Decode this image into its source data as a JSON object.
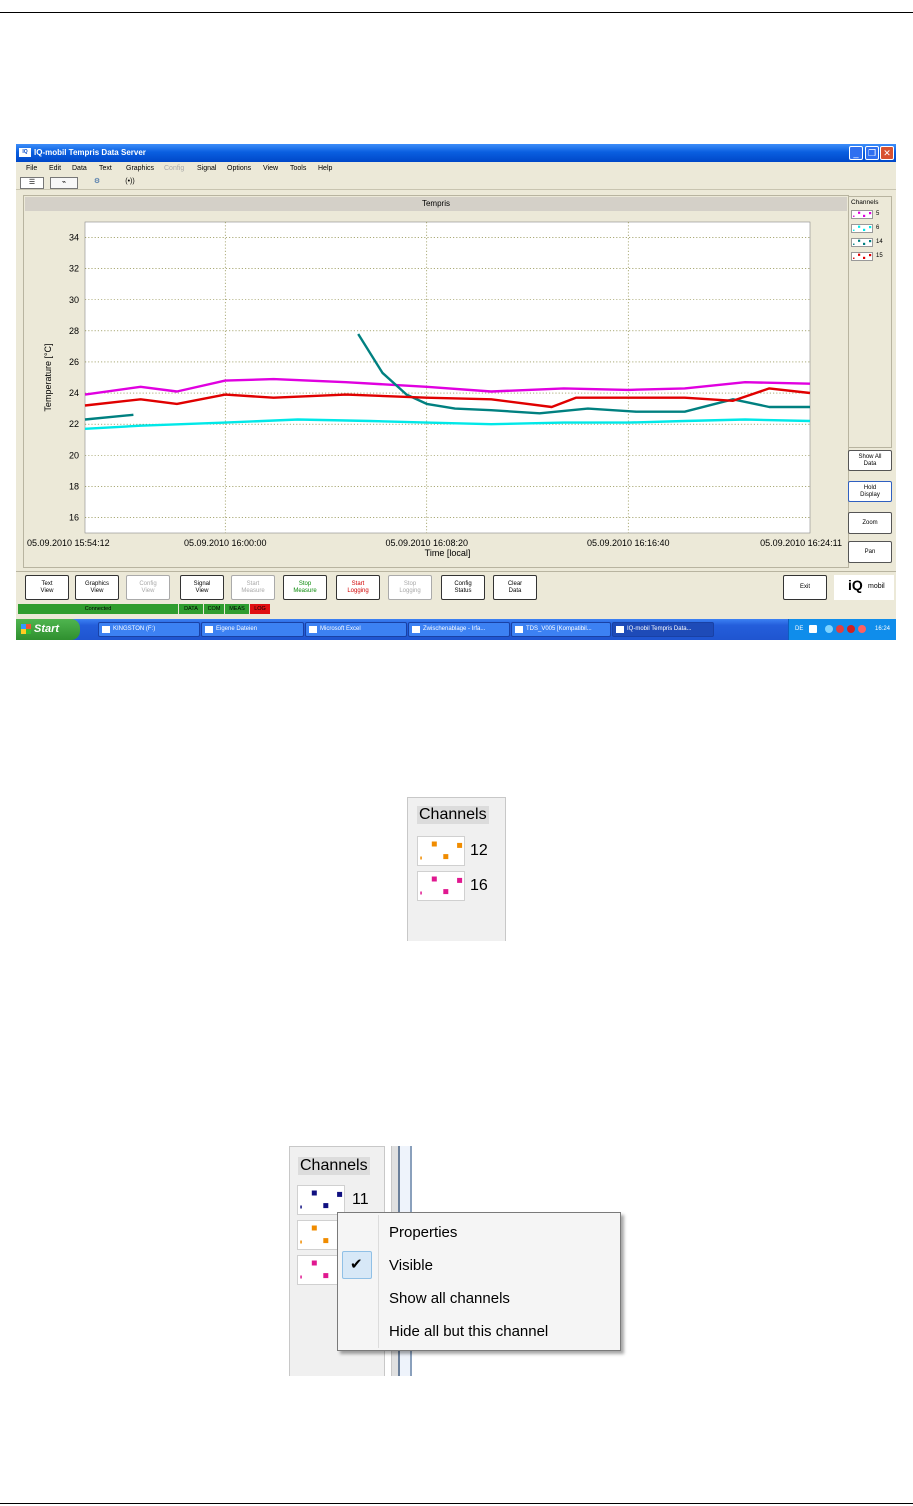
{
  "window": {
    "title": "IQ-mobil Tempris Data Server",
    "app_icon": "IQ",
    "controls": [
      "_",
      "❐",
      "✕"
    ]
  },
  "menu": [
    "File",
    "Edit",
    "Data",
    "Text",
    "Graphics",
    "Config",
    "Signal",
    "Options",
    "View",
    "Tools",
    "Help"
  ],
  "menu_disabled": "Config",
  "toolbar_tabs": [
    {
      "icon": "text-view-icon",
      "glyph": "☰"
    },
    {
      "icon": "graphics-view-icon",
      "glyph": "⌁"
    },
    {
      "icon": "config-view-icon",
      "glyph": "⚙"
    },
    {
      "icon": "signal-icon",
      "glyph": "(•))"
    }
  ],
  "chart_data": {
    "type": "line",
    "title": "Tempris",
    "xlabel": "Time [local]",
    "ylabel": "Temperature [°C]",
    "ylim": [
      15,
      35
    ],
    "yticks": [
      16,
      18,
      20,
      22,
      24,
      26,
      28,
      30,
      32,
      34
    ],
    "xlim": [
      "05.09.2010 15:54:12",
      "05.09.2010 16:24:11"
    ],
    "xticks": [
      "05.09.2010 15:54:12",
      "05.09.2010 16:00:00",
      "05.09.2010 16:08:20",
      "05.09.2010 16:16:40",
      "05.09.2010 16:24:11"
    ],
    "grid": true,
    "series": [
      {
        "name": "5",
        "color": "#e000e0",
        "x": [
          "15:54:12",
          "15:56:30",
          "15:58:00",
          "16:00:00",
          "16:02:00",
          "16:05:00",
          "16:08:20",
          "16:11:00",
          "16:14:00",
          "16:16:40",
          "16:19:00",
          "16:21:30",
          "16:24:11"
        ],
        "values": [
          23.9,
          24.4,
          24.1,
          24.8,
          24.9,
          24.7,
          24.4,
          24.1,
          24.3,
          24.2,
          24.3,
          24.7,
          24.6
        ]
      },
      {
        "name": "6",
        "color": "#00e8e8",
        "x": [
          "15:54:12",
          "15:56:30",
          "16:00:00",
          "16:03:00",
          "16:06:00",
          "16:08:20",
          "16:11:00",
          "16:14:00",
          "16:16:40",
          "16:19:00",
          "16:21:30",
          "16:24:11"
        ],
        "values": [
          21.7,
          21.9,
          22.1,
          22.3,
          22.2,
          22.1,
          22.0,
          22.1,
          22.1,
          22.2,
          22.3,
          22.2
        ]
      },
      {
        "name": "14",
        "color": "#008080",
        "segments": [
          {
            "x": [
              "15:54:12",
              "15:55:30",
              "15:56:12"
            ],
            "values": [
              22.3,
              22.5,
              22.6
            ]
          },
          {
            "x": [
              "16:05:30",
              "16:06:30",
              "16:07:30",
              "16:08:20",
              "16:09:30",
              "16:11:00",
              "16:13:00",
              "16:15:00",
              "16:17:00",
              "16:19:00",
              "16:21:00",
              "16:22:30",
              "16:24:11"
            ],
            "values": [
              27.8,
              25.3,
              23.9,
              23.3,
              23.0,
              22.9,
              22.7,
              23.0,
              22.8,
              22.8,
              23.6,
              23.1,
              23.1
            ]
          }
        ]
      },
      {
        "name": "15",
        "color": "#e00000",
        "x": [
          "15:54:12",
          "15:56:30",
          "15:58:00",
          "16:00:00",
          "16:02:00",
          "16:05:00",
          "16:08:20",
          "16:11:00",
          "16:13:30",
          "16:14:30",
          "16:16:40",
          "16:19:00",
          "16:21:00",
          "16:22:30",
          "16:24:11"
        ],
        "values": [
          23.2,
          23.6,
          23.3,
          23.9,
          23.7,
          23.9,
          23.7,
          23.6,
          23.1,
          23.7,
          23.7,
          23.7,
          23.5,
          24.3,
          24.0
        ]
      }
    ]
  },
  "channel_panel": {
    "header": "Channels",
    "channels": [
      {
        "num": "5",
        "color": "#e000e0"
      },
      {
        "num": "6",
        "color": "#00e8e8"
      },
      {
        "num": "14",
        "color": "#008080"
      },
      {
        "num": "15",
        "color": "#e00000"
      }
    ]
  },
  "side_buttons": [
    "Show All\nData",
    "Hold\nDisplay",
    "Zoom",
    "Pan"
  ],
  "bottom_buttons": [
    {
      "label": "Text\nView",
      "state": "normal"
    },
    {
      "label": "Graphics\nView",
      "state": "normal"
    },
    {
      "label": "Config\nView",
      "state": "disabled"
    },
    {
      "label": "Signal\nView",
      "state": "normal"
    },
    {
      "label": "Start\nMeasure",
      "state": "disabled"
    },
    {
      "label": "Stop\nMeasure",
      "state": "green"
    },
    {
      "label": "Start\nLogging",
      "state": "red"
    },
    {
      "label": "Stop\nLogging",
      "state": "disabled"
    },
    {
      "label": "Config\nStatus",
      "state": "normal"
    },
    {
      "label": "Clear\nData",
      "state": "normal"
    }
  ],
  "exit_label": "Exit",
  "logo": {
    "big": "iQ",
    "small": "mobil"
  },
  "status": {
    "connected": "Connected",
    "indicators": [
      {
        "label": "DATA",
        "color": "#2f9d2f"
      },
      {
        "label": "COM",
        "color": "#2f9d2f"
      },
      {
        "label": "MEAS",
        "color": "#2f9d2f"
      },
      {
        "label": "LOG",
        "color": "#e01010"
      }
    ]
  },
  "taskbar": {
    "start": "Start",
    "tasks": [
      "KINGSTON (F:)",
      "Eigene Dateien",
      "Microsoft Excel",
      "Zwischenablage - Irfa...",
      "TDS_V005 [Kompatibil...",
      "IQ-mobil Tempris Data..."
    ],
    "lang": "DE",
    "clock": "16:24"
  },
  "crop1": {
    "header": "Channels",
    "channels": [
      {
        "num": "12",
        "color": "#f08c00"
      },
      {
        "num": "16",
        "color": "#e01890"
      }
    ]
  },
  "crop2": {
    "header": "Channels",
    "channels": [
      {
        "num": "11",
        "color": "#101080"
      },
      {
        "num": "",
        "color": "#f08c00"
      },
      {
        "num": "",
        "color": "#e01890"
      }
    ],
    "context_menu": [
      "Properties",
      "Visible",
      "Show all channels",
      "Hide all but this channel"
    ],
    "checked_item": "Visible"
  }
}
